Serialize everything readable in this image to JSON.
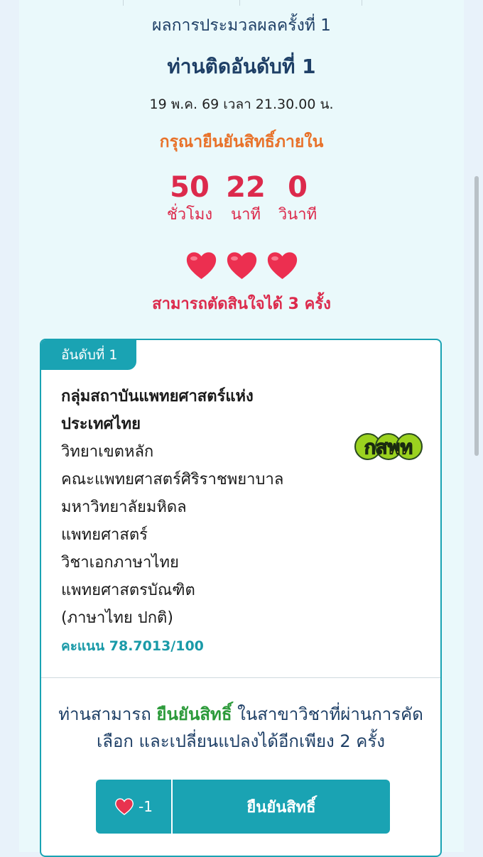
{
  "header": {
    "round_title": "ผลการประมวลผลครั้งที่ 1",
    "rank_title": "ท่านติดอันดับที่ 1",
    "datetime": "19 พ.ค. 69 เวลา 21.30.00 น."
  },
  "deadline": {
    "label": "กรุณายืนยันสิทธิ์ภายใน",
    "hours_value": "50",
    "hours_label": "ชั่วโมง",
    "minutes_value": "22",
    "minutes_label": "นาที",
    "seconds_value": "0",
    "seconds_label": "วินาที"
  },
  "lives": {
    "count": 3,
    "icon": "heart-icon",
    "text": "สามารถตัดสินใจได้ 3 ครั้ง"
  },
  "result_card": {
    "badge": "อันดับที่ 1",
    "group_line1": "กลุ่มสถาบันแพทยศาสตร์แห่ง",
    "group_line2": "ประเทศไทย",
    "campus": "วิทยาเขตหลัก",
    "faculty": "คณะแพทยศาสตร์ศิริราชพยาบาล",
    "university": "มหาวิทยาลัยมหิดล",
    "field": "แพทยศาสตร์",
    "major": "วิชาเอกภาษาไทย",
    "degree": "แพทยศาสตรบัณฑิต",
    "program": "(ภาษาไทย ปกติ)",
    "score": "คะแนน 78.7013/100",
    "logo_text": "กสพท"
  },
  "info": {
    "part1": "ท่านสามารถ ",
    "highlight": "ยืนยันสิทธิ์",
    "part2": " ในสาขาวิชาที่ผ่านการคัด",
    "line2": "เลือก และเปลี่ยนแปลงได้อีกเพียง 2 ครั้ง"
  },
  "confirm_button": {
    "cost": "-1",
    "label": "ยืนยันสิทธิ์"
  },
  "colors": {
    "accent": "#1aa3b3",
    "title": "#1e3f66",
    "warning": "#e8722a",
    "countdown": "#dc2a4c",
    "highlight": "#2c9a3a"
  }
}
